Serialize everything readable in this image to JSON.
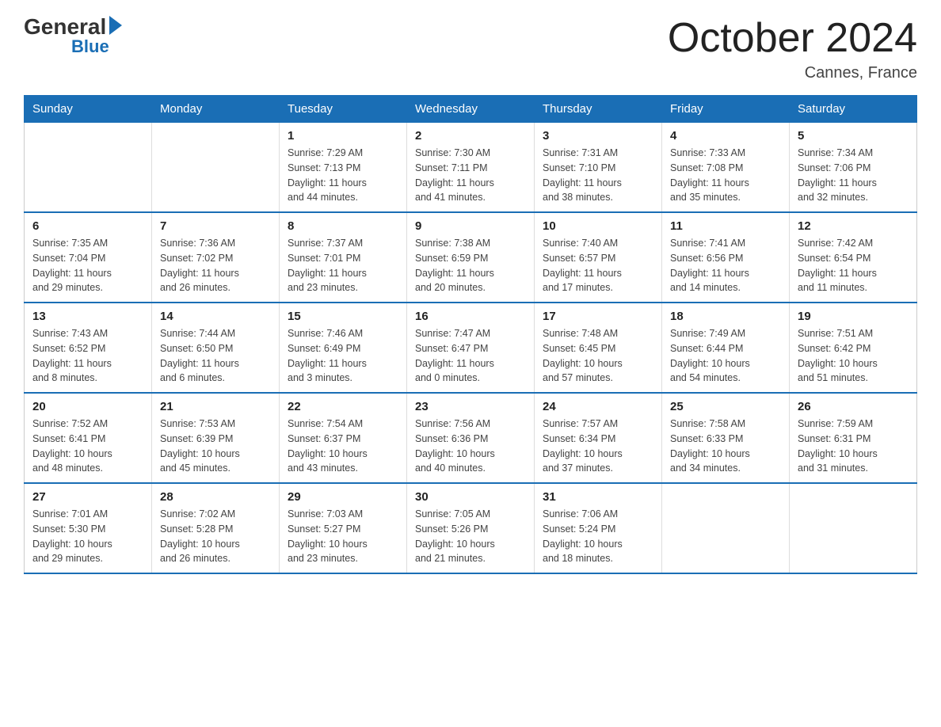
{
  "logo": {
    "general": "General",
    "blue": "Blue"
  },
  "title": "October 2024",
  "location": "Cannes, France",
  "days_header": [
    "Sunday",
    "Monday",
    "Tuesday",
    "Wednesday",
    "Thursday",
    "Friday",
    "Saturday"
  ],
  "weeks": [
    [
      {
        "day": "",
        "info": ""
      },
      {
        "day": "",
        "info": ""
      },
      {
        "day": "1",
        "info": "Sunrise: 7:29 AM\nSunset: 7:13 PM\nDaylight: 11 hours\nand 44 minutes."
      },
      {
        "day": "2",
        "info": "Sunrise: 7:30 AM\nSunset: 7:11 PM\nDaylight: 11 hours\nand 41 minutes."
      },
      {
        "day": "3",
        "info": "Sunrise: 7:31 AM\nSunset: 7:10 PM\nDaylight: 11 hours\nand 38 minutes."
      },
      {
        "day": "4",
        "info": "Sunrise: 7:33 AM\nSunset: 7:08 PM\nDaylight: 11 hours\nand 35 minutes."
      },
      {
        "day": "5",
        "info": "Sunrise: 7:34 AM\nSunset: 7:06 PM\nDaylight: 11 hours\nand 32 minutes."
      }
    ],
    [
      {
        "day": "6",
        "info": "Sunrise: 7:35 AM\nSunset: 7:04 PM\nDaylight: 11 hours\nand 29 minutes."
      },
      {
        "day": "7",
        "info": "Sunrise: 7:36 AM\nSunset: 7:02 PM\nDaylight: 11 hours\nand 26 minutes."
      },
      {
        "day": "8",
        "info": "Sunrise: 7:37 AM\nSunset: 7:01 PM\nDaylight: 11 hours\nand 23 minutes."
      },
      {
        "day": "9",
        "info": "Sunrise: 7:38 AM\nSunset: 6:59 PM\nDaylight: 11 hours\nand 20 minutes."
      },
      {
        "day": "10",
        "info": "Sunrise: 7:40 AM\nSunset: 6:57 PM\nDaylight: 11 hours\nand 17 minutes."
      },
      {
        "day": "11",
        "info": "Sunrise: 7:41 AM\nSunset: 6:56 PM\nDaylight: 11 hours\nand 14 minutes."
      },
      {
        "day": "12",
        "info": "Sunrise: 7:42 AM\nSunset: 6:54 PM\nDaylight: 11 hours\nand 11 minutes."
      }
    ],
    [
      {
        "day": "13",
        "info": "Sunrise: 7:43 AM\nSunset: 6:52 PM\nDaylight: 11 hours\nand 8 minutes."
      },
      {
        "day": "14",
        "info": "Sunrise: 7:44 AM\nSunset: 6:50 PM\nDaylight: 11 hours\nand 6 minutes."
      },
      {
        "day": "15",
        "info": "Sunrise: 7:46 AM\nSunset: 6:49 PM\nDaylight: 11 hours\nand 3 minutes."
      },
      {
        "day": "16",
        "info": "Sunrise: 7:47 AM\nSunset: 6:47 PM\nDaylight: 11 hours\nand 0 minutes."
      },
      {
        "day": "17",
        "info": "Sunrise: 7:48 AM\nSunset: 6:45 PM\nDaylight: 10 hours\nand 57 minutes."
      },
      {
        "day": "18",
        "info": "Sunrise: 7:49 AM\nSunset: 6:44 PM\nDaylight: 10 hours\nand 54 minutes."
      },
      {
        "day": "19",
        "info": "Sunrise: 7:51 AM\nSunset: 6:42 PM\nDaylight: 10 hours\nand 51 minutes."
      }
    ],
    [
      {
        "day": "20",
        "info": "Sunrise: 7:52 AM\nSunset: 6:41 PM\nDaylight: 10 hours\nand 48 minutes."
      },
      {
        "day": "21",
        "info": "Sunrise: 7:53 AM\nSunset: 6:39 PM\nDaylight: 10 hours\nand 45 minutes."
      },
      {
        "day": "22",
        "info": "Sunrise: 7:54 AM\nSunset: 6:37 PM\nDaylight: 10 hours\nand 43 minutes."
      },
      {
        "day": "23",
        "info": "Sunrise: 7:56 AM\nSunset: 6:36 PM\nDaylight: 10 hours\nand 40 minutes."
      },
      {
        "day": "24",
        "info": "Sunrise: 7:57 AM\nSunset: 6:34 PM\nDaylight: 10 hours\nand 37 minutes."
      },
      {
        "day": "25",
        "info": "Sunrise: 7:58 AM\nSunset: 6:33 PM\nDaylight: 10 hours\nand 34 minutes."
      },
      {
        "day": "26",
        "info": "Sunrise: 7:59 AM\nSunset: 6:31 PM\nDaylight: 10 hours\nand 31 minutes."
      }
    ],
    [
      {
        "day": "27",
        "info": "Sunrise: 7:01 AM\nSunset: 5:30 PM\nDaylight: 10 hours\nand 29 minutes."
      },
      {
        "day": "28",
        "info": "Sunrise: 7:02 AM\nSunset: 5:28 PM\nDaylight: 10 hours\nand 26 minutes."
      },
      {
        "day": "29",
        "info": "Sunrise: 7:03 AM\nSunset: 5:27 PM\nDaylight: 10 hours\nand 23 minutes."
      },
      {
        "day": "30",
        "info": "Sunrise: 7:05 AM\nSunset: 5:26 PM\nDaylight: 10 hours\nand 21 minutes."
      },
      {
        "day": "31",
        "info": "Sunrise: 7:06 AM\nSunset: 5:24 PM\nDaylight: 10 hours\nand 18 minutes."
      },
      {
        "day": "",
        "info": ""
      },
      {
        "day": "",
        "info": ""
      }
    ]
  ]
}
